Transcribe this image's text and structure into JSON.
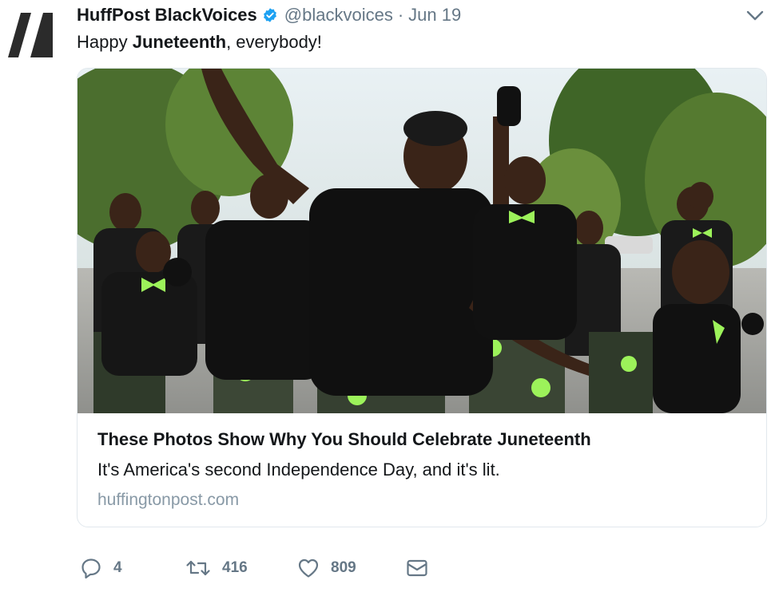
{
  "tweet": {
    "author": {
      "display_name": "HuffPost BlackVoices",
      "handle": "@blackvoices",
      "verified": true
    },
    "separator": "·",
    "date": "Jun 19",
    "text_before": "Happy ",
    "text_bold": "Juneteenth",
    "text_after": ", everybody!"
  },
  "card": {
    "image_icon": "photo-of-dancing-youth",
    "title": "These Photos Show Why You Should Celebrate Juneteenth",
    "description": "It's America's second Independence Day, and it's lit.",
    "domain": "huffingtonpost.com"
  },
  "actions": {
    "reply_count": "4",
    "retweet_count": "416",
    "like_count": "809",
    "icons": [
      "reply-icon",
      "retweet-icon",
      "heart-icon",
      "envelope-icon"
    ]
  },
  "colors": {
    "text": "#14171a",
    "secondary": "#657786",
    "domain": "#8899a6",
    "verified": "#1da1f2",
    "border": "#e1e8ed",
    "accent_green": "#9cf25a"
  }
}
